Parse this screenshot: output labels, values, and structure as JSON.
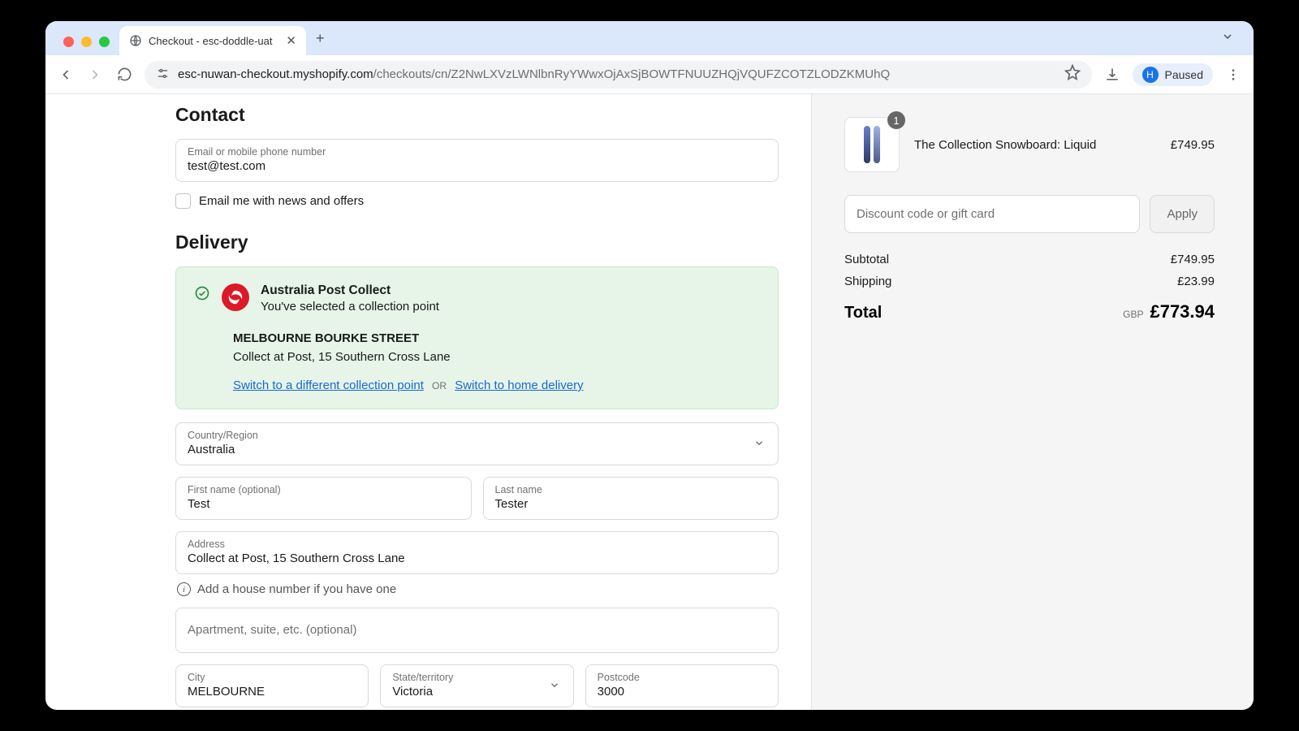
{
  "browser": {
    "tab_title": "Checkout - esc-doddle-uat",
    "url_host": "esc-nuwan-checkout.myshopify.com",
    "url_path": "/checkouts/cn/Z2NwLXVzLWNlbnRyYWwxOjAxSjBOWTFNUUZHQjVQUFZCOTZLODZKMUhQ",
    "paused_label": "Paused",
    "avatar_initial": "H"
  },
  "contact": {
    "heading": "Contact",
    "email_label": "Email or mobile phone number",
    "email_value": "test@test.com",
    "news_checkbox": "Email me with news and offers"
  },
  "delivery": {
    "heading": "Delivery",
    "collection": {
      "title": "Australia Post Collect",
      "subtitle": "You've selected a collection point",
      "point_name": "MELBOURNE BOURKE STREET",
      "point_address": "Collect at Post, 15 Southern Cross Lane",
      "switch_point": "Switch to a different collection point",
      "or": "OR",
      "switch_home": "Switch to home delivery"
    },
    "country_label": "Country/Region",
    "country_value": "Australia",
    "first_name_label": "First name (optional)",
    "first_name_value": "Test",
    "last_name_label": "Last name",
    "last_name_value": "Tester",
    "address_label": "Address",
    "address_value": "Collect at Post, 15 Southern Cross Lane",
    "house_number_hint": "Add a house number if you have one",
    "apt_placeholder": "Apartment, suite, etc. (optional)",
    "city_label": "City",
    "city_value": "MELBOURNE",
    "state_label": "State/territory",
    "state_value": "Victoria",
    "postcode_label": "Postcode",
    "postcode_value": "3000"
  },
  "cart": {
    "item_name": "The Collection Snowboard: Liquid",
    "item_qty": "1",
    "item_price": "£749.95",
    "discount_placeholder": "Discount code or gift card",
    "apply_label": "Apply",
    "subtotal_label": "Subtotal",
    "subtotal_value": "£749.95",
    "shipping_label": "Shipping",
    "shipping_value": "£23.99",
    "total_label": "Total",
    "total_currency": "GBP",
    "total_value": "£773.94"
  }
}
